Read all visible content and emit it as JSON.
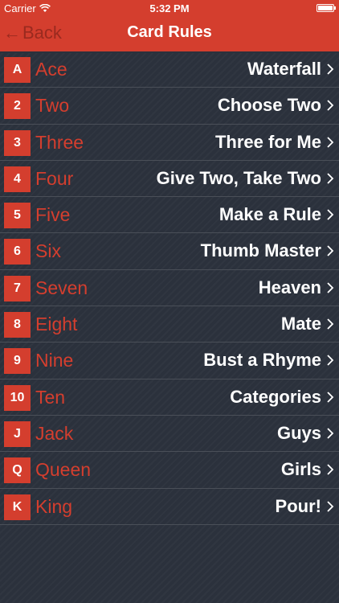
{
  "status": {
    "carrier": "Carrier",
    "time": "5:32 PM"
  },
  "nav": {
    "back_label": "Back",
    "title": "Card Rules"
  },
  "cards": [
    {
      "badge": "A",
      "name": "Ace",
      "rule": "Waterfall"
    },
    {
      "badge": "2",
      "name": "Two",
      "rule": "Choose Two"
    },
    {
      "badge": "3",
      "name": "Three",
      "rule": "Three for Me"
    },
    {
      "badge": "4",
      "name": "Four",
      "rule": "Give Two, Take Two"
    },
    {
      "badge": "5",
      "name": "Five",
      "rule": "Make a Rule"
    },
    {
      "badge": "6",
      "name": "Six",
      "rule": "Thumb Master"
    },
    {
      "badge": "7",
      "name": "Seven",
      "rule": "Heaven"
    },
    {
      "badge": "8",
      "name": "Eight",
      "rule": "Mate"
    },
    {
      "badge": "9",
      "name": "Nine",
      "rule": "Bust a Rhyme"
    },
    {
      "badge": "10",
      "name": "Ten",
      "rule": "Categories"
    },
    {
      "badge": "J",
      "name": "Jack",
      "rule": "Guys"
    },
    {
      "badge": "Q",
      "name": "Queen",
      "rule": "Girls"
    },
    {
      "badge": "K",
      "name": "King",
      "rule": "Pour!"
    }
  ]
}
